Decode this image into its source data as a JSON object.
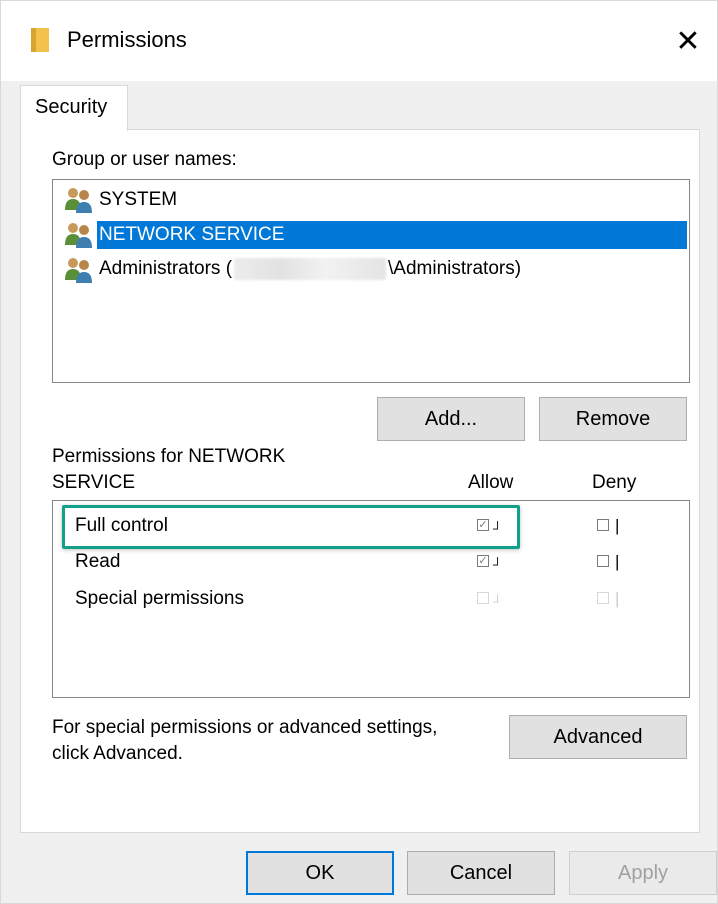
{
  "window": {
    "title": "Permissions",
    "close_glyph": "✕"
  },
  "tabs": [
    {
      "label": "Security",
      "active": true
    }
  ],
  "group_label": "Group or user names:",
  "users": [
    {
      "name": "SYSTEM",
      "selected": false
    },
    {
      "name": "NETWORK SERVICE",
      "selected": true
    },
    {
      "name": "Administrators (",
      "suffix": "\\Administrators)",
      "redacted": true,
      "selected": false
    }
  ],
  "buttons": {
    "add": "Add...",
    "remove": "Remove",
    "advanced": "Advanced",
    "ok": "OK",
    "cancel": "Cancel",
    "apply": "Apply"
  },
  "permissions_header": {
    "line1": "Permissions for NETWORK",
    "line2": "SERVICE",
    "allow": "Allow",
    "deny": "Deny"
  },
  "permissions": [
    {
      "name": "Full control",
      "allow": true,
      "deny": false,
      "enabled": true
    },
    {
      "name": "Read",
      "allow": true,
      "deny": false,
      "enabled": true
    },
    {
      "name": "Special permissions",
      "allow": false,
      "deny": false,
      "enabled": false
    }
  ],
  "advanced_note": {
    "line1": "For special permissions or advanced settings,",
    "line2": "click Advanced."
  },
  "colors": {
    "selection": "#0078d7",
    "highlight": "#12a08a",
    "folder": "#f2c24c"
  }
}
